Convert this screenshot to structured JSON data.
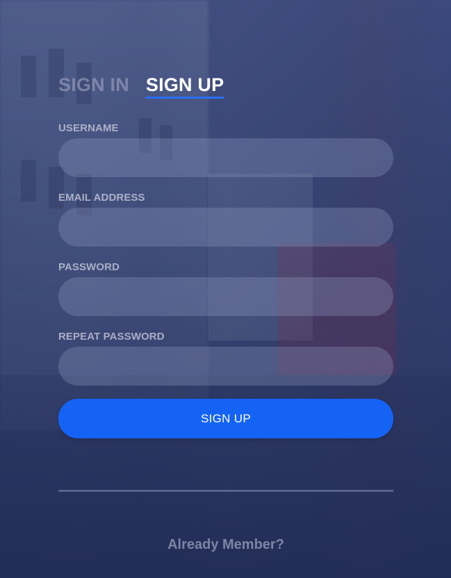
{
  "tabs": [
    {
      "label": "SIGN IN",
      "active": false
    },
    {
      "label": "SIGN UP",
      "active": true
    }
  ],
  "form": {
    "fields": [
      {
        "label": "USERNAME",
        "value": "",
        "placeholder": ""
      },
      {
        "label": "EMAIL ADDRESS",
        "value": "",
        "placeholder": ""
      },
      {
        "label": "PASSWORD",
        "value": "",
        "placeholder": ""
      },
      {
        "label": "REPEAT PASSWORD",
        "value": "",
        "placeholder": ""
      }
    ],
    "submit_label": "SIGN UP"
  },
  "footer": {
    "member_link": "Already Member?"
  },
  "colors": {
    "accent": "#1463f5",
    "tab_underline": "#2a6df5",
    "overlay": "#2f3d70"
  }
}
